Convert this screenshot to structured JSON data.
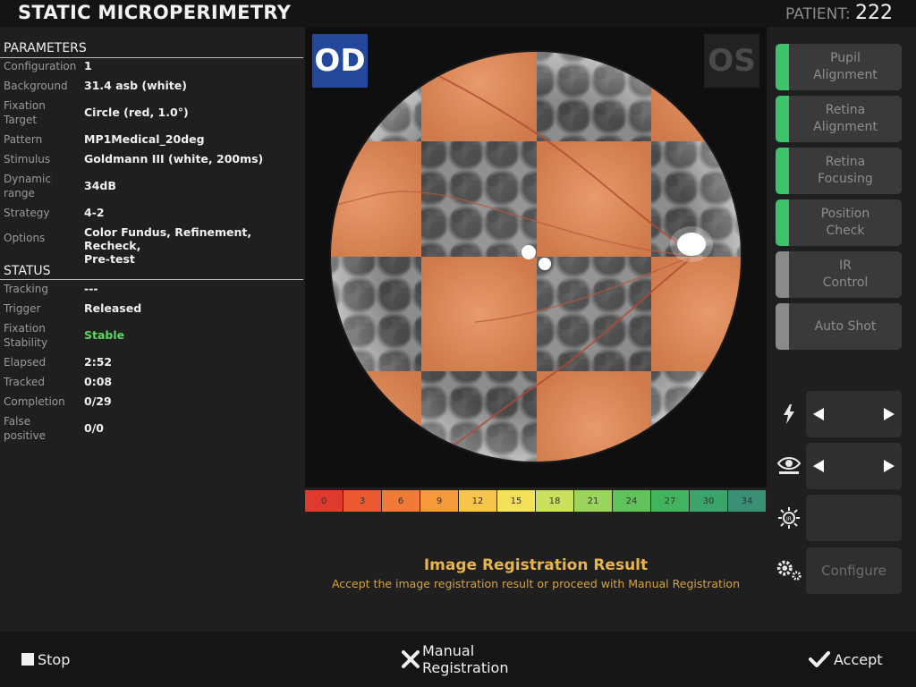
{
  "header": {
    "title": "STATIC MICROPERIMETRY",
    "patient_label": "PATIENT:",
    "patient_id": "222"
  },
  "parameters": {
    "title": "PARAMETERS",
    "rows": [
      {
        "label": "Configuration",
        "value": "1"
      },
      {
        "label": "Background",
        "value": "31.4 asb (white)"
      },
      {
        "label": "Fixation\nTarget",
        "value": "Circle (red, 1.0°)"
      },
      {
        "label": "Pattern",
        "value": "MP1Medical_20deg"
      },
      {
        "label": "Stimulus",
        "value": "Goldmann III (white, 200ms)"
      },
      {
        "label": "Dynamic\nrange",
        "value": "34dB"
      },
      {
        "label": "Strategy",
        "value": "4-2"
      },
      {
        "label": "Options",
        "value": "Color Fundus, Refinement, Recheck,\nPre-test"
      }
    ]
  },
  "status": {
    "title": "STATUS",
    "rows": [
      {
        "label": "Tracking",
        "value": "---"
      },
      {
        "label": "Trigger",
        "value": "Released"
      },
      {
        "label": "Fixation\nStability",
        "value": "Stable"
      },
      {
        "label": "Elapsed",
        "value": "2:52"
      },
      {
        "label": "Tracked",
        "value": "0:08"
      },
      {
        "label": "Completion",
        "value": "0/29"
      },
      {
        "label": "False\npositive",
        "value": "0/0"
      }
    ]
  },
  "eye": {
    "od": "OD",
    "os": "OS"
  },
  "scale": {
    "values": [
      "0",
      "3",
      "6",
      "9",
      "12",
      "15",
      "18",
      "21",
      "24",
      "27",
      "30",
      "34"
    ],
    "colors": [
      "#e03a2e",
      "#ec5a32",
      "#f07a36",
      "#f59a3a",
      "#f7c54a",
      "#f3e15a",
      "#cbe05a",
      "#9ad45a",
      "#5fc25a",
      "#43b45e",
      "#3aa46a",
      "#3a8f76"
    ]
  },
  "registration": {
    "title": "Image Registration Result",
    "subtitle": "Accept the image registration result or proceed with Manual Registration"
  },
  "side_buttons": [
    {
      "label": "Pupil\nAlignment",
      "done": true
    },
    {
      "label": "Retina\nAlignment",
      "done": true
    },
    {
      "label": "Retina\nFocusing",
      "done": true
    },
    {
      "label": "Position\nCheck",
      "done": true
    },
    {
      "label": "IR\nControl",
      "done": false
    },
    {
      "label": "Auto Shot",
      "done": false
    }
  ],
  "controls": {
    "flash_icon": "lightning-icon",
    "eye_icon": "eye-icon",
    "ir_icon": "ir-light-icon",
    "gear_icon": "gears-icon",
    "configure": "Configure"
  },
  "bottom": {
    "stop": "Stop",
    "manual": "Manual\nRegistration",
    "accept": "Accept"
  }
}
